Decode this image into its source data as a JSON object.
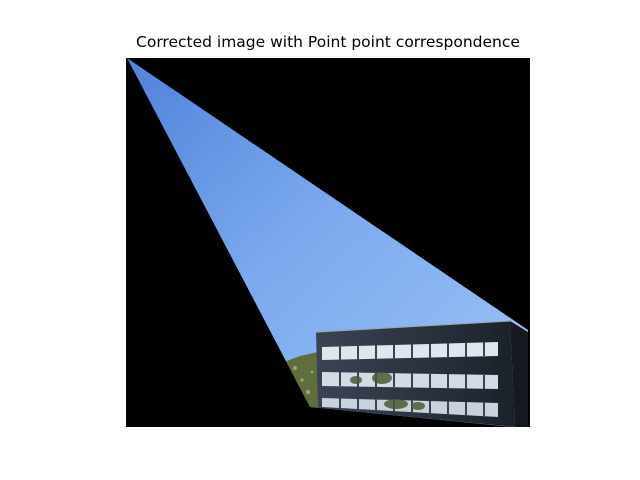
{
  "figure": {
    "title": "Corrected image with Point point correspondence"
  },
  "image": {
    "background_color": "#000000",
    "sky_gradient": [
      "#5c8ee0",
      "#8cb8f4"
    ],
    "building_facade_color": "#2c3644",
    "window_color": "#dfe6ee",
    "vegetation_color": "#5f6e3c"
  }
}
